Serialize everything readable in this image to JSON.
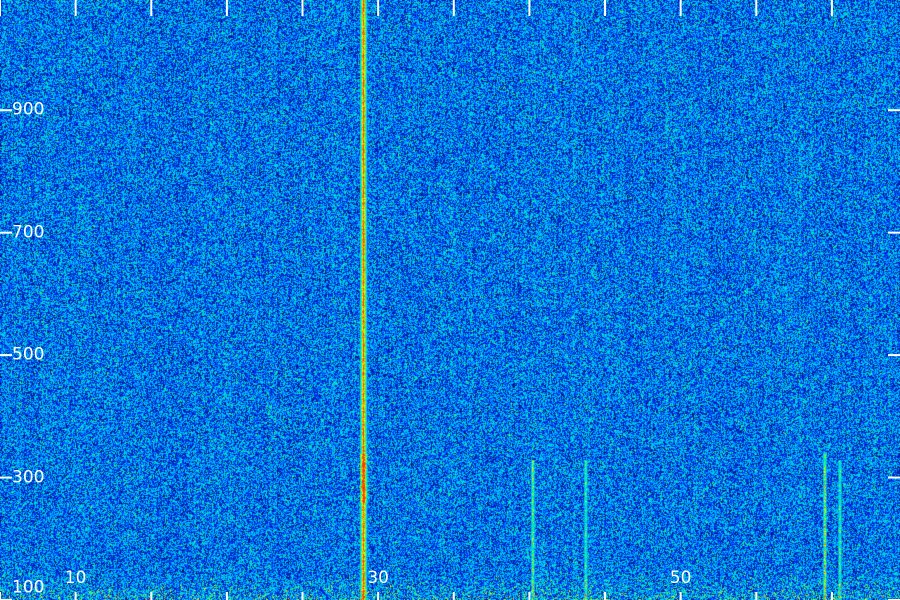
{
  "chart_data": {
    "type": "heatmap",
    "title": "",
    "xlabel": "",
    "ylabel": "",
    "xlim": [
      5,
      64.5
    ],
    "ylim": [
      100,
      1080
    ],
    "x_tick_labels": [
      {
        "value": 10,
        "label": "10"
      },
      {
        "value": 30,
        "label": "30"
      },
      {
        "value": 50,
        "label": "50"
      }
    ],
    "x_minor_ticks": [
      5,
      10,
      15,
      20,
      25,
      30,
      35,
      40,
      45,
      50,
      55,
      60
    ],
    "y_tick_labels": [
      {
        "value": 100,
        "label": "100"
      },
      {
        "value": 300,
        "label": "300"
      },
      {
        "value": 500,
        "label": "500"
      },
      {
        "value": 700,
        "label": "700"
      },
      {
        "value": 900,
        "label": "900"
      }
    ],
    "grid": false,
    "colormap": [
      "#000010",
      "#001070",
      "#0033ff",
      "#00c8ff",
      "#00ff80",
      "#ffff00",
      "#ff3300"
    ],
    "features": [
      {
        "kind": "strong-vertical-line",
        "x": 29.0,
        "y_from": 100,
        "y_to": 1080,
        "intensity": 0.75,
        "hotspot": [
          260,
          340
        ]
      },
      {
        "kind": "vertical-line",
        "x": 59.5,
        "y_from": 100,
        "y_to": 340,
        "intensity": 0.55
      },
      {
        "kind": "vertical-line",
        "x": 40.2,
        "y_from": 100,
        "y_to": 330,
        "intensity": 0.45
      },
      {
        "kind": "vertical-line",
        "x": 43.7,
        "y_from": 100,
        "y_to": 330,
        "intensity": 0.42
      },
      {
        "kind": "vertical-line",
        "x": 60.5,
        "y_from": 100,
        "y_to": 330,
        "intensity": 0.4
      },
      {
        "kind": "low-band",
        "y_from": 100,
        "y_to": 160,
        "intensity": 0.45
      }
    ]
  }
}
